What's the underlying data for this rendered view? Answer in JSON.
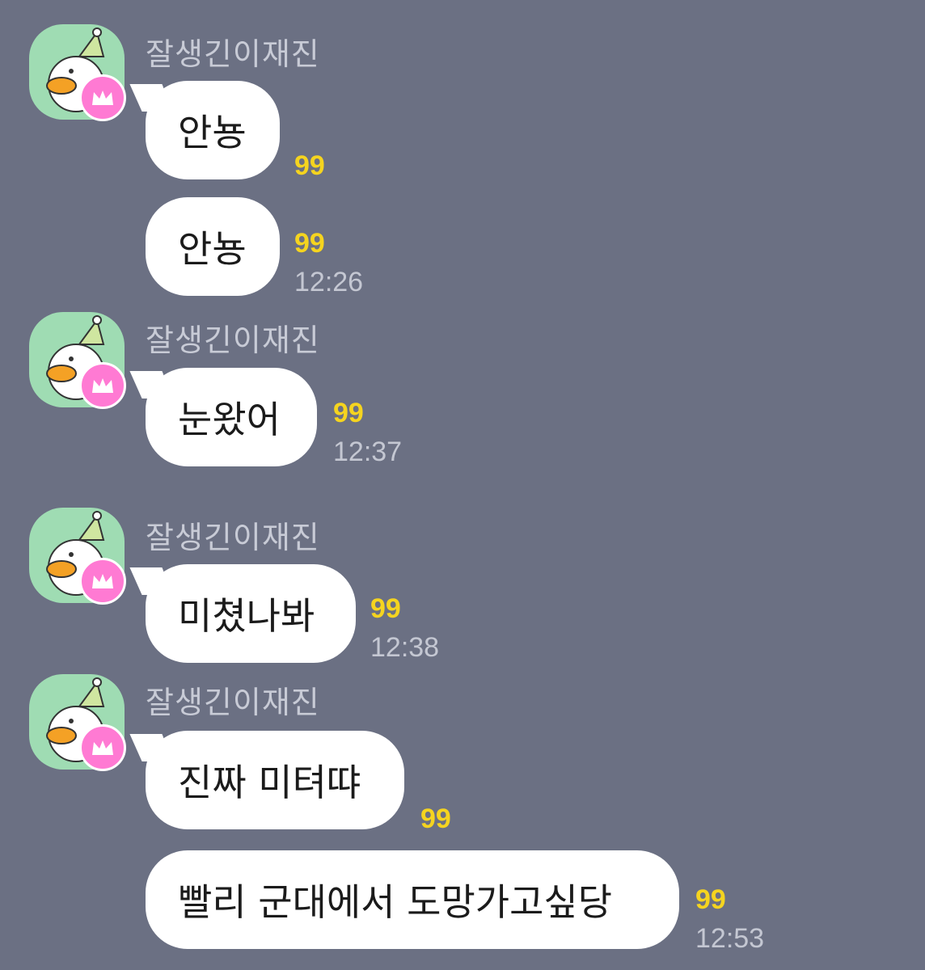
{
  "colors": {
    "background": "#6b7083",
    "bubble": "#ffffff",
    "unread_count": "#f5d41f",
    "avatar_bg": "#9fdcb3",
    "badge": "#ff7ad3"
  },
  "messages": [
    {
      "sender": "잘생긴이재진",
      "text": "안뇽",
      "unread": "99",
      "time": ""
    },
    {
      "sender": "",
      "text": "안뇽",
      "unread": "99",
      "time": "12:26"
    },
    {
      "sender": "잘생긴이재진",
      "text": "눈왔어",
      "unread": "99",
      "time": "12:37"
    },
    {
      "sender": "잘생긴이재진",
      "text": "미쳤나봐",
      "unread": "99",
      "time": "12:38"
    },
    {
      "sender": "잘생긴이재진",
      "text": "진짜 미텨땨",
      "unread": "99",
      "time": ""
    },
    {
      "sender": "",
      "text": "빨리 군대에서 도망가고싶당",
      "unread": "99",
      "time": "12:53"
    }
  ],
  "icons": {
    "avatar": "duck-character-avatar-icon",
    "badge": "crown-icon"
  }
}
